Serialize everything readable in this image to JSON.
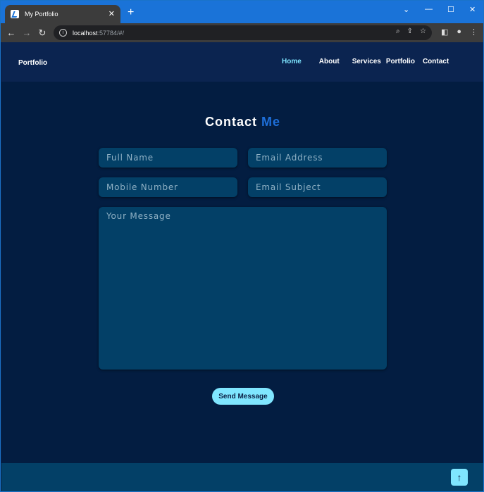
{
  "browser": {
    "tab_title": "My Portfolio",
    "tab_close": "✕",
    "new_tab": "+",
    "url_host": "localhost",
    "url_rest": ":57784/#/",
    "win_min": "—",
    "win_max": "☐",
    "win_close": "✕",
    "win_chevron": "⌄"
  },
  "nav": {
    "brand": "Portfolio",
    "items": [
      "Home",
      "About",
      "Services",
      "Portfolio",
      "Contact"
    ],
    "active": "Home"
  },
  "contact": {
    "title_white": "Contact",
    "title_blue": "Me",
    "fields": {
      "full_name": "Full Name",
      "email": "Email Address",
      "mobile": "Mobile Number",
      "subject": "Email Subject",
      "message": "Your Message"
    },
    "send_label": "Send Message"
  },
  "footer": {
    "top_icon": "↑"
  },
  "colors": {
    "accent": "#7fe6ff",
    "title_blue": "#1e6fd9",
    "page_bg": "#031d41",
    "field_bg": "#034067"
  }
}
